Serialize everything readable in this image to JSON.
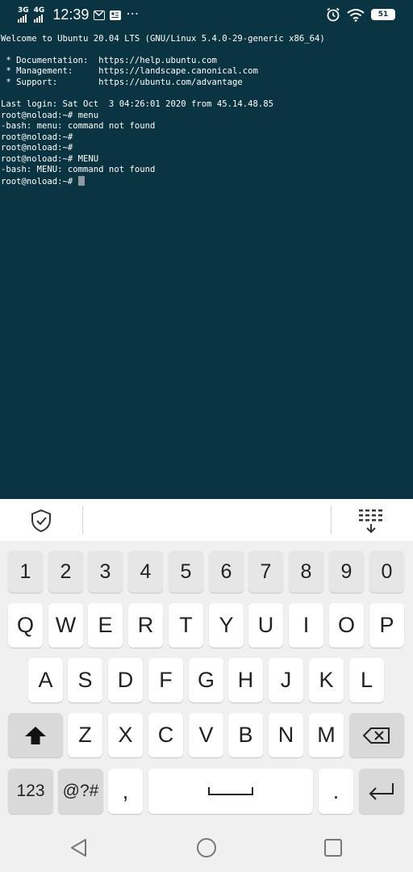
{
  "status_bar": {
    "network_1": "3G",
    "network_2": "4G",
    "time": "12:39",
    "more": "⋯",
    "battery": "51",
    "icons": [
      "signal-icon",
      "gmail-icon",
      "news-icon",
      "alarm-icon",
      "wifi-icon",
      "battery-icon"
    ]
  },
  "terminal": {
    "lines": [
      "Welcome to Ubuntu 20.04 LTS (GNU/Linux 5.4.0-29-generic x86_64)",
      "",
      " * Documentation:  https://help.ubuntu.com",
      " * Management:     https://landscape.canonical.com",
      " * Support:        https://ubuntu.com/advantage",
      "",
      "Last login: Sat Oct  3 04:26:01 2020 from 45.14.48.85",
      "root@noload:~# menu",
      "-bash: menu: command not found",
      "root@noload:~#",
      "root@noload:~#",
      "root@noload:~# MENU",
      "-bash: MENU: command not found",
      "root@noload:~# "
    ],
    "colors": {
      "background": "#0b3442",
      "text": "#ffffff",
      "cursor": "#8a9aa0"
    }
  },
  "keyboard": {
    "toolbar_icons": [
      "shield-check-icon",
      "keyboard-hide-icon"
    ],
    "number_row": [
      "1",
      "2",
      "3",
      "4",
      "5",
      "6",
      "7",
      "8",
      "9",
      "0"
    ],
    "row1": [
      "Q",
      "W",
      "E",
      "R",
      "T",
      "Y",
      "U",
      "I",
      "O",
      "P"
    ],
    "row2": [
      "A",
      "S",
      "D",
      "F",
      "G",
      "H",
      "J",
      "K",
      "L"
    ],
    "row3": [
      "Z",
      "X",
      "C",
      "V",
      "B",
      "N",
      "M"
    ],
    "bottom": {
      "numbers_label": "123",
      "symbols_label": "@?#",
      "comma": ",",
      "period": ".",
      "shift_icon": "shift-icon",
      "backspace_icon": "backspace-icon",
      "space_icon": "space-icon",
      "enter_icon": "enter-icon"
    }
  },
  "navigation_bar": {
    "icons": [
      "back-icon",
      "home-icon",
      "recents-icon"
    ]
  }
}
